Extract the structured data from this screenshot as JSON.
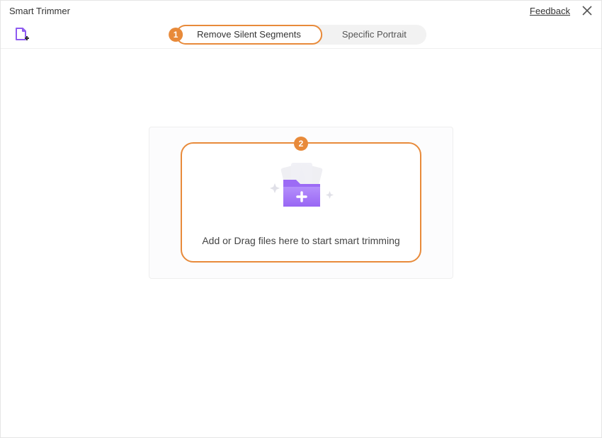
{
  "window": {
    "title": "Smart Trimmer"
  },
  "header": {
    "feedback": "Feedback"
  },
  "tabs": {
    "remove_silent": "Remove Silent Segments",
    "specific_portrait": "Specific Portrait"
  },
  "annotations": {
    "step1": "1",
    "step2": "2"
  },
  "dropzone": {
    "text": "Add or Drag files here to start smart trimming"
  }
}
